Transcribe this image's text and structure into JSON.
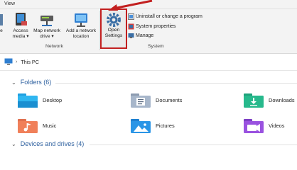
{
  "menu": {
    "view_label": "View"
  },
  "ribbon": {
    "cut_label": "e",
    "access_media_label": "Access\nmedia ▾",
    "map_drive_label": "Map network\ndrive ▾",
    "add_location_label": "Add a network\nlocation",
    "open_settings_label": "Open\nSettings",
    "uninstall_label": "Uninstall or change a program",
    "system_properties_label": "System properties",
    "manage_label": "Manage",
    "network_group_label": "Network",
    "system_group_label": "System"
  },
  "address_bar": {
    "crumb": "This PC"
  },
  "folders_section": {
    "header": "Folders (6)",
    "items": [
      {
        "label": "Desktop",
        "icon": "desktop-folder-icon"
      },
      {
        "label": "Documents",
        "icon": "documents-folder-icon"
      },
      {
        "label": "Downloads",
        "icon": "downloads-folder-icon"
      },
      {
        "label": "Music",
        "icon": "music-folder-icon"
      },
      {
        "label": "Pictures",
        "icon": "pictures-folder-icon"
      },
      {
        "label": "Videos",
        "icon": "videos-folder-icon"
      }
    ]
  },
  "devices_section": {
    "header": "Devices and drives (4)"
  },
  "colors": {
    "accent": "#2c5f9e",
    "highlight_border": "#c21f1f"
  }
}
